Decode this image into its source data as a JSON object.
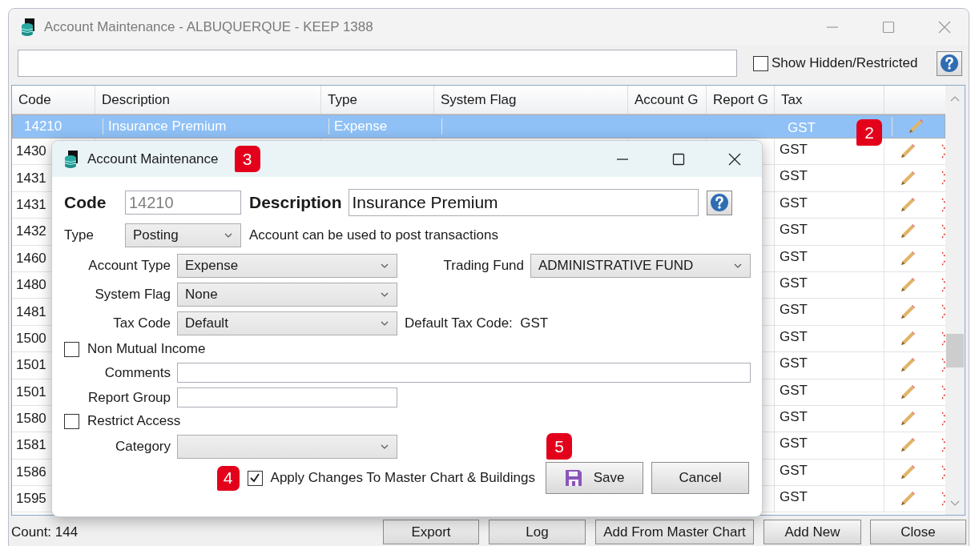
{
  "window": {
    "title": "Account Maintenance - ALBUQUERQUE - KEEP 1388"
  },
  "show_hidden": {
    "label": "Show Hidden/Restricted",
    "checked": false
  },
  "table": {
    "columns": [
      "Code",
      "Description",
      "Type",
      "System Flag",
      "Account G",
      "Report G",
      "Tax"
    ],
    "badge": "2",
    "rows": [
      {
        "code": "14210",
        "description": "Insurance Premium",
        "type": "Expense",
        "tax": "GST",
        "selected": true
      },
      {
        "code": "1430",
        "tax": "GST",
        "selected": false
      },
      {
        "code": "1431",
        "tax": "GST",
        "selected": false
      },
      {
        "code": "1431",
        "tax": "GST",
        "selected": false
      },
      {
        "code": "1432",
        "tax": "GST",
        "selected": false
      },
      {
        "code": "1460",
        "tax": "GST",
        "selected": false
      },
      {
        "code": "1480",
        "tax": "GST",
        "selected": false
      },
      {
        "code": "1481",
        "tax": "GST",
        "selected": false
      },
      {
        "code": "1500",
        "tax": "GST",
        "selected": false
      },
      {
        "code": "1501",
        "tax": "GST",
        "selected": false
      },
      {
        "code": "1501",
        "tax": "GST",
        "selected": false
      },
      {
        "code": "1580",
        "tax": "GST",
        "selected": false
      },
      {
        "code": "1581",
        "tax": "GST",
        "selected": false
      },
      {
        "code": "1586",
        "tax": "GST",
        "selected": false
      },
      {
        "code": "1595",
        "tax": "GST",
        "selected": false
      }
    ]
  },
  "count": "Count: 144",
  "buttons": [
    "Export",
    "Log",
    "Add From Master Chart",
    "Add New",
    "Close"
  ],
  "dialog": {
    "title": "Account Maintenance",
    "title_badge": "3",
    "code_label": "Code",
    "code_value": "14210",
    "description_label": "Description",
    "description_value": "Insurance Premium",
    "type_label": "Type",
    "type_value": "Posting",
    "type_note": "Account can be used to post transactions",
    "account_type": {
      "label": "Account Type",
      "value": "Expense"
    },
    "trading_fund": {
      "label": "Trading Fund",
      "value": "ADMINISTRATIVE FUND"
    },
    "system_flag": {
      "label": "System Flag",
      "value": "None"
    },
    "tax_code": {
      "label": "Tax Code",
      "value": "Default"
    },
    "tax_note": "Default Tax Code:  GST",
    "non_mutual": {
      "label": "Non Mutual Income",
      "checked": false
    },
    "comments": {
      "label": "Comments"
    },
    "report_group": {
      "label": "Report Group"
    },
    "restrict": {
      "label": "Restrict Access",
      "checked": false
    },
    "category": {
      "label": "Category"
    },
    "apply": {
      "label": "Apply Changes To Master Chart & Buildings",
      "checked": true,
      "badge": "4"
    },
    "save": {
      "label": "Save",
      "badge": "5"
    },
    "cancel": "Cancel"
  }
}
